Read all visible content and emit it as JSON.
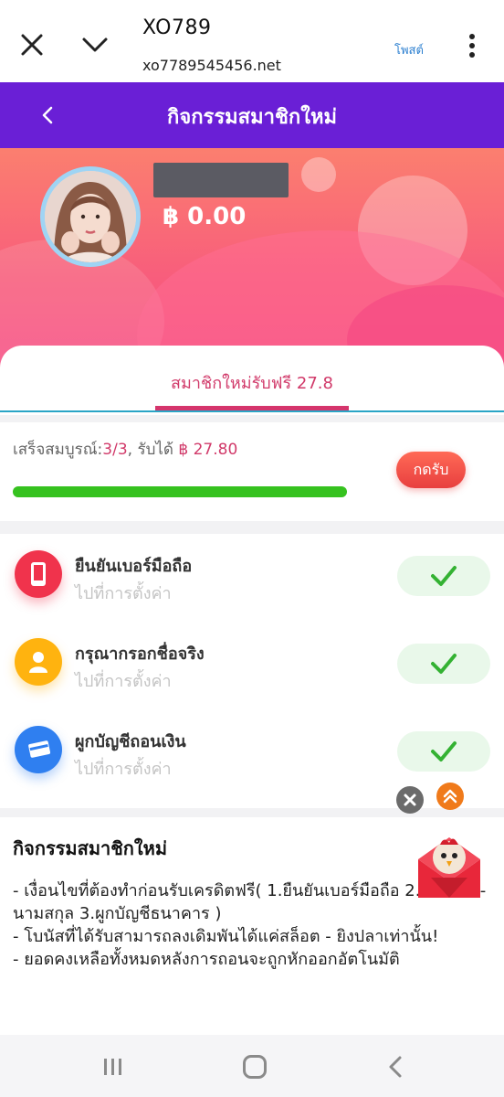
{
  "browser": {
    "site_title": "XO789",
    "url": "xo7789545456.net",
    "post_label": "โพสต์"
  },
  "header": {
    "title": "กิจกรรมสมาชิกใหม่"
  },
  "profile": {
    "balance": "฿ 0.00"
  },
  "tab": {
    "label": "สมาชิกใหม่รับฟรี 27.8"
  },
  "progress": {
    "prefix": "เสร็จสมบูรณ์:",
    "count": "3/3",
    "middle": ", รับได้ ",
    "amount": "฿ 27.80",
    "claim_label": "กดรับ",
    "fraction": 1.0
  },
  "tasks": [
    {
      "title": "ยืนยันเบอร์มือถือ",
      "subtitle": "ไปที่การตั้งค่า",
      "icon": "phone-icon",
      "color": "#f0334c",
      "done": true
    },
    {
      "title": "กรุณากรอกชื่อจริง",
      "subtitle": "ไปที่การตั้งค่า",
      "icon": "user-icon",
      "color": "#ffb30f",
      "done": true
    },
    {
      "title": "ผูกบัญชีถอนเงิน",
      "subtitle": "ไปที่การตั้งค่า",
      "icon": "card-icon",
      "color": "#2f7ff0",
      "done": true
    }
  ],
  "description": {
    "title": "กิจกรรมสมาชิกใหม่",
    "lines": [
      "- เงื่อนไขที่ต้องทำก่อนรับเครดิตฟรี( 1.ยืนยันเบอร์มือถือ  2.กรอกชื่อ-นามสกุล  3.ผูกบัญชีธนาคาร )",
      "- โบนัสที่ได้รับสามารถลงเดิมพันได้แค่สล็อต - ยิงปลาเท่านั้น!",
      "- ยอดคงเหลือทั้งหมดหลังการถอนจะถูกหักออกอัตโนมัติ"
    ]
  },
  "colors": {
    "header_purple": "#6a1fd6",
    "accent_pink": "#d13a6a",
    "progress_green": "#36c21f",
    "check_green": "#34b233"
  }
}
